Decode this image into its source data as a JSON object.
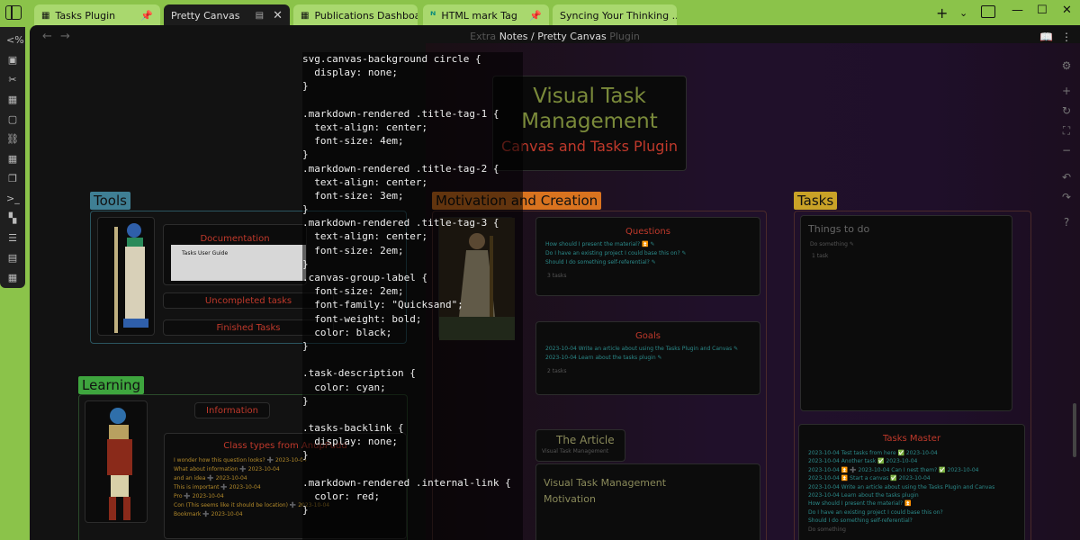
{
  "tabs": [
    {
      "label": "Tasks Plugin",
      "icon": "grid-icon",
      "pinned": true,
      "active": false
    },
    {
      "label": "Pretty Canvas",
      "icon": "grid-icon",
      "active": true
    },
    {
      "label": "Publications Dashboard",
      "icon": "grid-icon",
      "active": false
    },
    {
      "label": "HTML mark Tag",
      "icon": "n-icon",
      "pinned": true,
      "active": false
    },
    {
      "label": "Syncing Your Thinking ...",
      "icon": "canvas-icon",
      "active": false
    }
  ],
  "header": {
    "breadcrumb_folder": "Notes",
    "breadcrumb_sep": "/",
    "title": "Pretty Canvas",
    "ghost_text": "Extra",
    "ghost_text2": "Plugin"
  },
  "title_card": {
    "line1": "Visual Task",
    "line2": "Management",
    "subtitle": "Canvas and Tasks Plugin"
  },
  "groups": {
    "tools": "Tools",
    "motivation": "Motivation and Creation",
    "tasks": "Tasks",
    "learning": "Learning"
  },
  "tools": {
    "documentation": "Documentation",
    "doc_preview": "Tasks User Guide",
    "uncompleted": "Uncompleted tasks",
    "finished": "Finished Tasks"
  },
  "learning": {
    "information": "Information",
    "class_types": "Class types from AnupPudd",
    "items": [
      "I wonder how this question looks? ➕ 2023-10-04",
      "What about information ➕ 2023-10-04",
      "and an idea ➕ 2023-10-04",
      "This is important ➕ 2023-10-04",
      "Pro ➕ 2023-10-04",
      "Con (This seems like it should be location) ➕ 2023-10-04",
      "Bookmark ➕ 2023-10-04"
    ]
  },
  "questions": {
    "title": "Questions",
    "items": [
      "How should I present the material? ⏫ ✎",
      "Do I have an existing project I could base this on? ✎",
      "Should I do something self-referential? ✎"
    ],
    "count": "3 tasks"
  },
  "goals": {
    "title": "Goals",
    "items": [
      "2023-10-04 Write an article about using the Tasks Plugin and Canvas ✎",
      "2023-10-04 Learn about the tasks plugin ✎"
    ],
    "count": "2 tasks"
  },
  "article": {
    "title": "The Article",
    "link": "Visual Task Management",
    "body_line1": "Visual Task Management",
    "body_line2": "Motivation"
  },
  "things": {
    "title": "Things to do",
    "item": "Do something ✎",
    "count": "1 task"
  },
  "tasks_master": {
    "title": "Tasks Master",
    "items": [
      "2023-10-04 Test tasks from here ✅ 2023-10-04",
      "2023-10-04 Another task ✅ 2023-10-04",
      "2023-10-04 ⏫ ➕ 2023-10-04 Can I nest them? ✅ 2023-10-04",
      "2023-10-04 ⏫ Start a canvas ✅ 2023-10-04",
      "2023-10-04 Write an article about using the Tasks Plugin and Canvas",
      "2023-10-04 Learn about the tasks plugin",
      "How should I present the material? ⏫",
      "Do I have an existing project I could base this on?",
      "Should I do something self-referential?",
      "Do something"
    ]
  },
  "code_lines": [
    "svg.canvas-background circle {",
    "  display: none;",
    "}",
    "",
    ".markdown-rendered .title-tag-1 {",
    "  text-align: center;",
    "  font-size: 4em;",
    "}",
    ".markdown-rendered .title-tag-2 {",
    "  text-align: center;",
    "  font-size: 3em;",
    "}",
    ".markdown-rendered .title-tag-3 {",
    "  text-align: center;",
    "  font-size: 2em;",
    "}",
    ".canvas-group-label {",
    "  font-size: 2em;",
    "  font-family: \"Quicksand\";",
    "  font-weight: bold;",
    "  color: black;",
    "}",
    "",
    ".task-description {",
    "  color: cyan;",
    "}",
    "",
    ".tasks-backlink {",
    "  display: none;",
    "}",
    "",
    ".markdown-rendered .internal-link {",
    "  color: red;",
    "}"
  ],
  "colors": {
    "app_accent": "#8bc34a",
    "tools_label": "#4a90a4",
    "motivation_label": "#d9731f",
    "tasks_label": "#c9a227",
    "learning_label": "#3ea53e",
    "card_title_red": "#c0392b",
    "task_cyan": "#2b8a8a",
    "title_green": "#7a8a3a"
  }
}
